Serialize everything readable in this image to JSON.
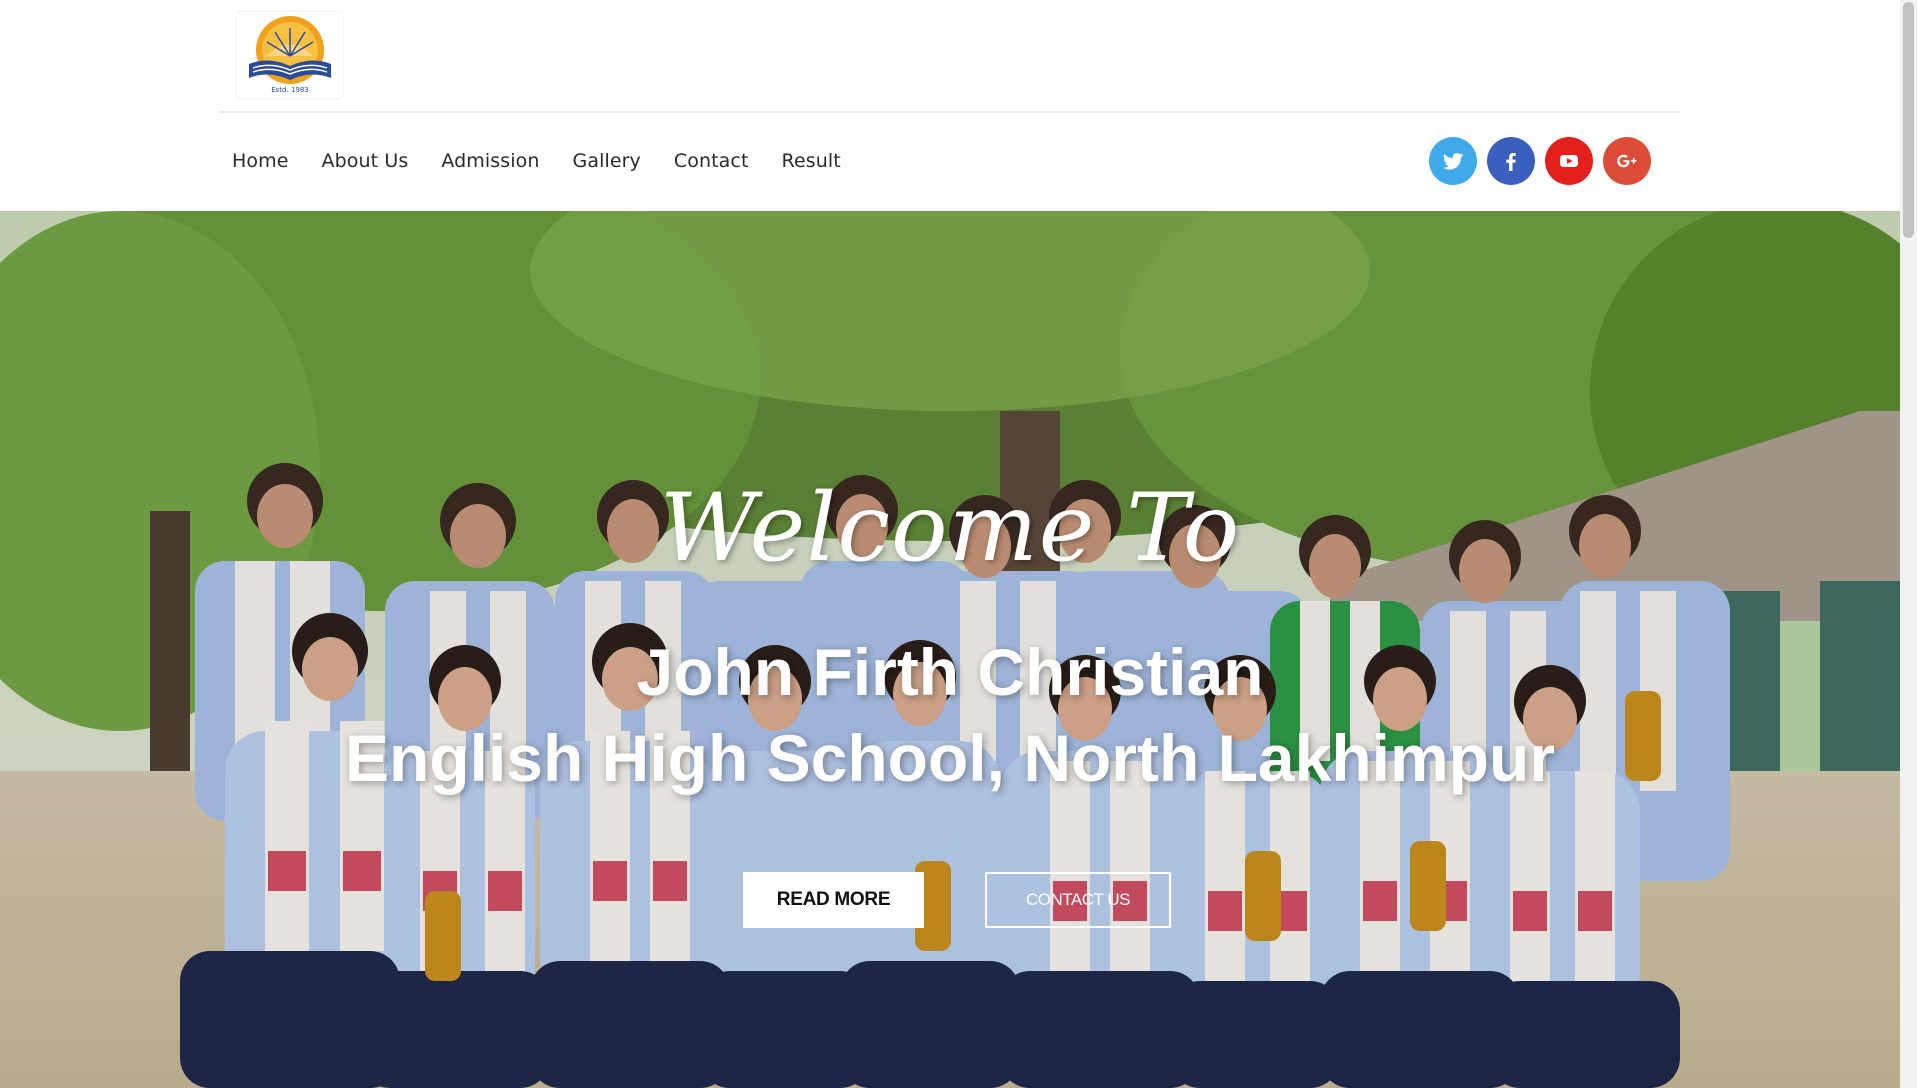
{
  "header": {
    "logo_alt": "John Firth Christian English High School logo",
    "logo_text": "Estd. 1983"
  },
  "nav": {
    "items": [
      {
        "label": "Home"
      },
      {
        "label": "About Us"
      },
      {
        "label": "Admission"
      },
      {
        "label": "Gallery"
      },
      {
        "label": "Contact"
      },
      {
        "label": "Result"
      }
    ]
  },
  "social": {
    "items": [
      {
        "icon": "twitter-icon",
        "color": "#3fa9ea"
      },
      {
        "icon": "facebook-icon",
        "color": "#3b5fbf"
      },
      {
        "icon": "youtube-icon",
        "color": "#e3201c"
      },
      {
        "icon": "google-plus-icon",
        "color": "#dd4b39"
      }
    ]
  },
  "hero": {
    "welcome": "Welcome To",
    "title_line1": "John Firth Christian",
    "title_line2": "English High School, North Lakhimpur",
    "read_more": "READ MORE",
    "contact_us": "CONTACT US",
    "image_description": "students in school uniforms posing outdoors under a large tree"
  }
}
